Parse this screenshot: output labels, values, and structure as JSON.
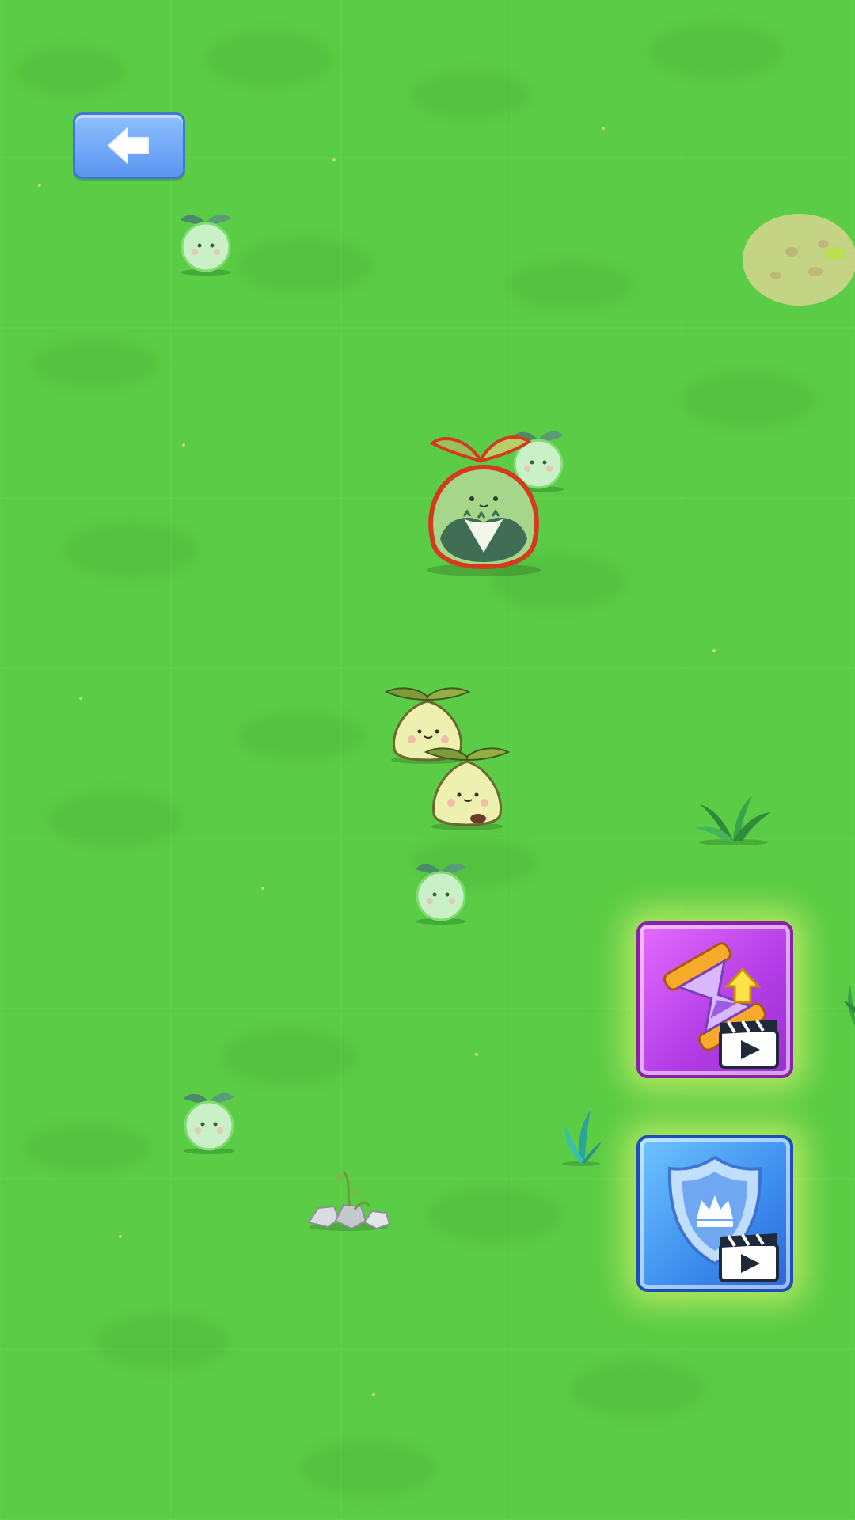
{
  "screen": {
    "name": "garden-battle-field",
    "background_color": "#5bcc45"
  },
  "controls": {
    "back_button": {
      "icon": "arrow-left-icon",
      "color": "#6aa4f6"
    },
    "boosts": [
      {
        "name": "speed-boost-ad",
        "icon": "hourglass-upgrade-icon",
        "badge": "video-play-icon",
        "color": "#c04ae8"
      },
      {
        "name": "shield-boost-ad",
        "icon": "crown-shield-icon",
        "badge": "video-play-icon",
        "color": "#3c8dee"
      }
    ]
  },
  "characters": [
    {
      "kind": "sprout-seedling",
      "count": 5
    },
    {
      "kind": "leafy-boss",
      "count": 1
    },
    {
      "kind": "onion-bulb",
      "count": 2
    }
  ],
  "decor": [
    "grass-tuft",
    "teal-plant",
    "rock-pile",
    "dirt-patch"
  ]
}
